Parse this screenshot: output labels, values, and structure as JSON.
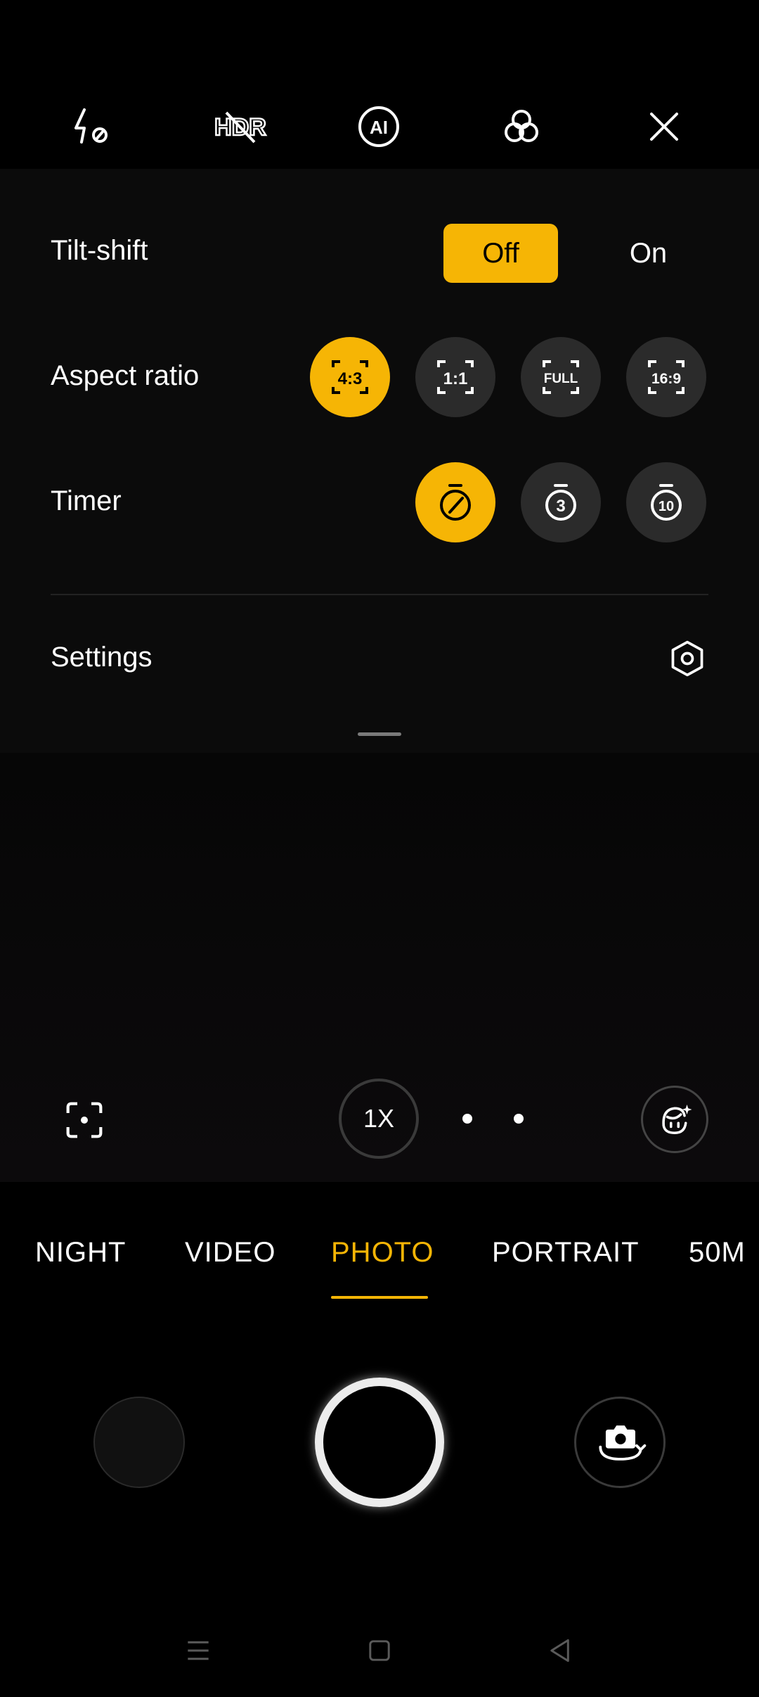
{
  "top_bar": {
    "icons": [
      "flash-off-icon",
      "hdr-off-icon",
      "ai-icon",
      "filter-icon",
      "close-icon"
    ],
    "hdr_label": "HDR",
    "ai_label": "AI"
  },
  "settings_panel": {
    "tilt_shift": {
      "label": "Tilt-shift",
      "options": [
        "Off",
        "On"
      ],
      "selected": "Off"
    },
    "aspect_ratio": {
      "label": "Aspect ratio",
      "options": [
        "4:3",
        "1:1",
        "FULL",
        "16:9"
      ],
      "selected": "4:3"
    },
    "timer": {
      "label": "Timer",
      "options": [
        "off",
        "3",
        "10"
      ],
      "selected": "off"
    },
    "settings_label": "Settings"
  },
  "viewfinder": {
    "zoom_label": "1X"
  },
  "modes": {
    "items": [
      "NIGHT",
      "VIDEO",
      "PHOTO",
      "PORTRAIT",
      "50M"
    ],
    "active": "PHOTO"
  },
  "colors": {
    "accent": "#f6b505",
    "background": "#000000",
    "button_bg": "#2b2b2b"
  }
}
